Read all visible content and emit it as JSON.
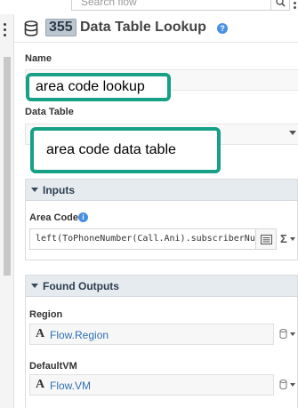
{
  "search": {
    "placeholder": "Search flow"
  },
  "header": {
    "step_number": "355",
    "title": "Data Table Lookup"
  },
  "name_field": {
    "label": "Name",
    "value": "area code lookup"
  },
  "data_table_field": {
    "label": "Data Table",
    "value": "area code data table"
  },
  "inputs_panel": {
    "title": "Inputs",
    "area_code": {
      "label": "Area Code",
      "value": "left(ToPhoneNumber(Call.Ani).subscriberNumber"
    }
  },
  "outputs_panel": {
    "title": "Found Outputs",
    "region": {
      "label": "Region",
      "value": "Flow.Region"
    },
    "default_vm": {
      "label": "DefaultVM",
      "value": "Flow.VM"
    }
  },
  "colors": {
    "highlight": "#16a085",
    "link": "#2f6fb6",
    "panel_header": "#e6ebf0"
  }
}
